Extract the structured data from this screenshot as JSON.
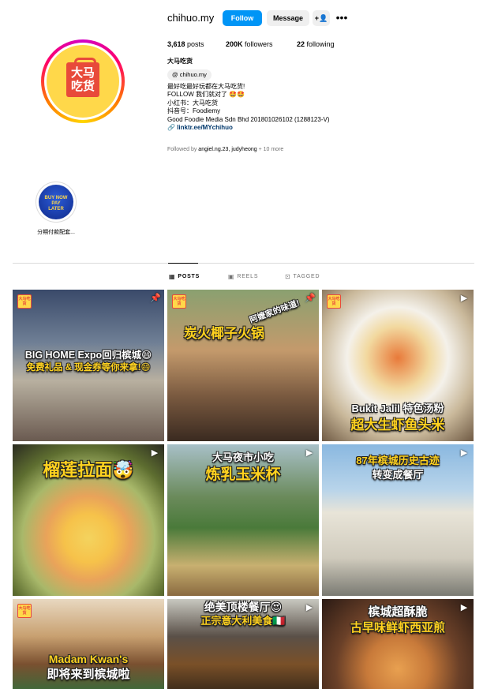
{
  "profile": {
    "username": "chihuo.my",
    "follow_label": "Follow",
    "message_label": "Message",
    "add_icon": "add-person-icon",
    "more_icon": "more-options-icon",
    "avatar_text": "大马\n吃货",
    "posts": "3,618",
    "posts_label": "posts",
    "followers": "200K",
    "followers_label": "followers",
    "following": "22",
    "following_label": "following",
    "display_name": "大马吃货",
    "threads_handle": "chihuo.my",
    "bio_lines": [
      "最好吃最好玩都在大马吃货!",
      "FOLLOW 我们就对了 🤩🤩",
      "小红书：大马吃货",
      "抖音号：Foodiemy",
      "Good Foodie Media Sdn Bhd 201801026102 (1288123-V)"
    ],
    "link": "linktr.ee/MYchihuo",
    "followed_by_prefix": "Followed by ",
    "followed_by_names": "angiel.ng.23, judyheong",
    "followed_by_suffix": " + 10 more"
  },
  "highlights": [
    {
      "label": "分期付款配套...",
      "image_text": "BUY NOW PAY LATER"
    }
  ],
  "tabs": [
    {
      "label": "POSTS",
      "icon": "grid-icon",
      "active": true
    },
    {
      "label": "REELS",
      "icon": "reels-icon",
      "active": false
    },
    {
      "label": "TAGGED",
      "icon": "tagged-icon",
      "active": false
    }
  ],
  "posts": [
    {
      "line1": "BIG HOME Expo回归槟城😄",
      "line2": "免费礼品 & 现金券等你来拿!😄",
      "type": "pinned"
    },
    {
      "line1": "炭火椰子火锅",
      "line2": "阿嬷家的味道!",
      "type": "pinned"
    },
    {
      "line1": "Bukit Jalil 特色汤粉",
      "line2": "超大生虾鱼头米",
      "type": "pinned"
    },
    {
      "line1": "榴莲拉面🤯",
      "line2": "",
      "type": "reel"
    },
    {
      "line1": "大马夜市小吃",
      "line2": "炼乳玉米杯",
      "type": "reel"
    },
    {
      "line1": "87年槟城历史古迹",
      "line2": "转变成餐厅",
      "type": "reel"
    },
    {
      "line1": "Madam Kwan's",
      "line2": "即将来到槟城啦",
      "type": "reel"
    },
    {
      "line1": "绝美顶楼餐厅😍",
      "line2": "正宗意大利美食🇮🇹",
      "type": "reel"
    },
    {
      "line1": "槟城超酥脆",
      "line2": "古早味鲜虾西亚煎",
      "type": "reel"
    }
  ],
  "badge_text": "大马吃货",
  "colors": {
    "follow_blue": "#0095f6",
    "caption_yellow": "#ffd21f",
    "link_blue": "#00376b"
  }
}
